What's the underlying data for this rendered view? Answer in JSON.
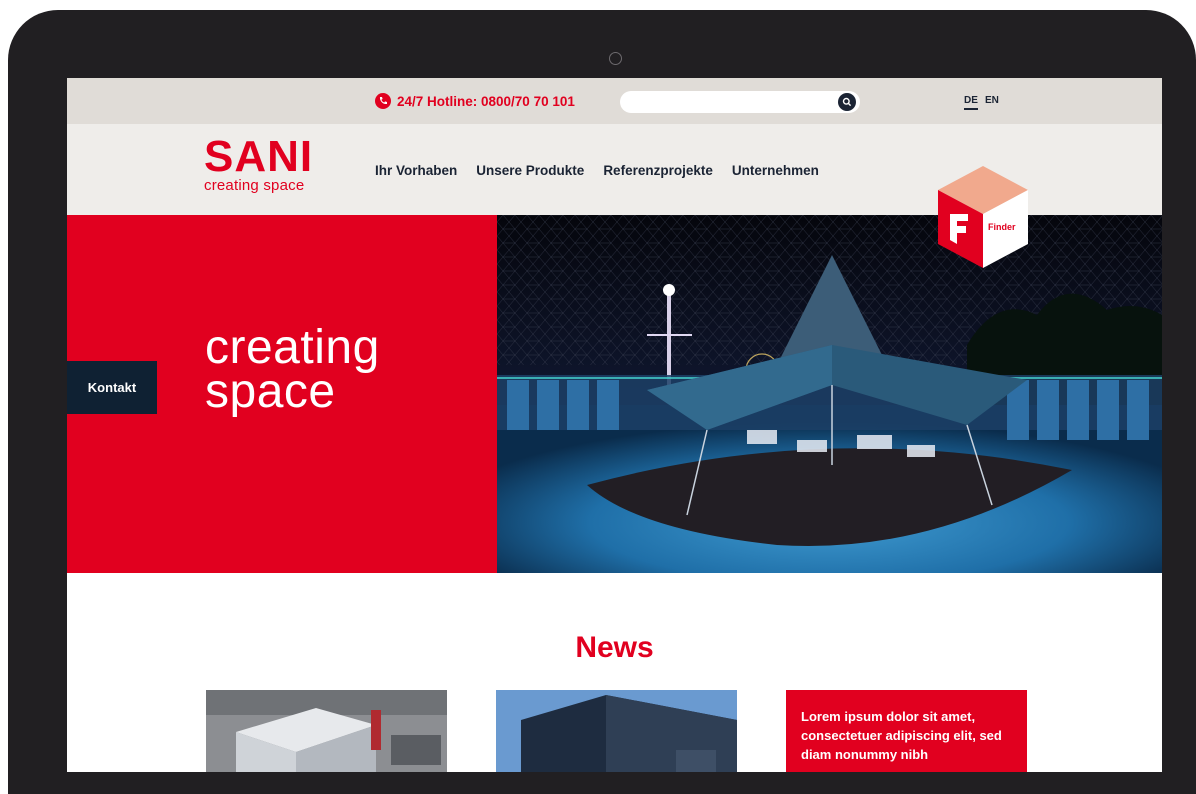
{
  "topbar": {
    "hotline": "24/7 Hotline: 0800/70 70 101",
    "search_placeholder": "",
    "languages": [
      "DE",
      "EN"
    ],
    "active_language": "DE"
  },
  "header": {
    "logo_word": "SANI",
    "logo_tagline": "creating space",
    "nav": [
      "Ihr Vorhaben",
      "Unsere Produkte",
      "Referenzprojekte",
      "Unternehmen"
    ]
  },
  "finder": {
    "letter": "F",
    "label": "Finder"
  },
  "hero": {
    "title_line1": "creating",
    "title_line2": "space",
    "kontakt_label": "Kontakt"
  },
  "news": {
    "title": "News",
    "card_text": "Lorem ipsum dolor sit amet, consectetuer adipiscing elit, sed diam nonummy nibh"
  },
  "colors": {
    "brand_red": "#e1001f",
    "navy": "#1b2434",
    "topbar_bg": "#e0dcd7",
    "header_bg": "#efedea"
  }
}
